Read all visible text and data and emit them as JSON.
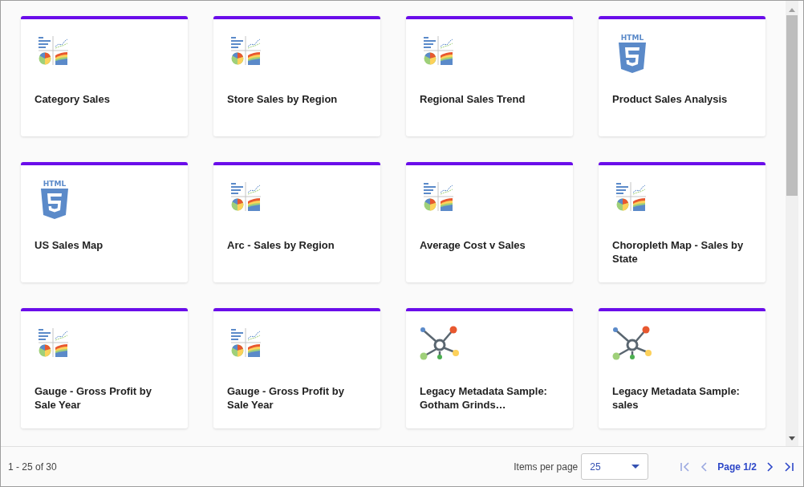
{
  "cards": [
    {
      "title": "Category Sales",
      "kind": "chart"
    },
    {
      "title": "Store Sales by Region",
      "kind": "chart"
    },
    {
      "title": "Regional Sales Trend",
      "kind": "chart"
    },
    {
      "title": "Product Sales Analysis",
      "kind": "html",
      "icon_label": "HTML"
    },
    {
      "title": "US Sales Map",
      "kind": "html",
      "icon_label": "HTML"
    },
    {
      "title": "Arc - Sales by Region",
      "kind": "chart"
    },
    {
      "title": "Average Cost v Sales",
      "kind": "chart"
    },
    {
      "title": "Choropleth Map - Sales by State",
      "kind": "chart"
    },
    {
      "title": "Gauge - Gross Profit by Sale Year",
      "kind": "chart"
    },
    {
      "title": "Gauge - Gross Profit by Sale Year",
      "kind": "chart"
    },
    {
      "title": "Legacy Metadata Sample: Gotham Grinds…",
      "kind": "metadata"
    },
    {
      "title": "Legacy Metadata Sample: sales",
      "kind": "metadata"
    }
  ],
  "footer": {
    "range": "1 - 25 of 30",
    "items_per_page_label": "Items per page",
    "items_per_page": "25",
    "page": "Page 1/2",
    "nav": [
      {
        "kind": "first",
        "disabled": true
      },
      {
        "kind": "prev",
        "disabled": true
      },
      {
        "kind": "next",
        "disabled": false
      },
      {
        "kind": "last",
        "disabled": false
      }
    ]
  }
}
